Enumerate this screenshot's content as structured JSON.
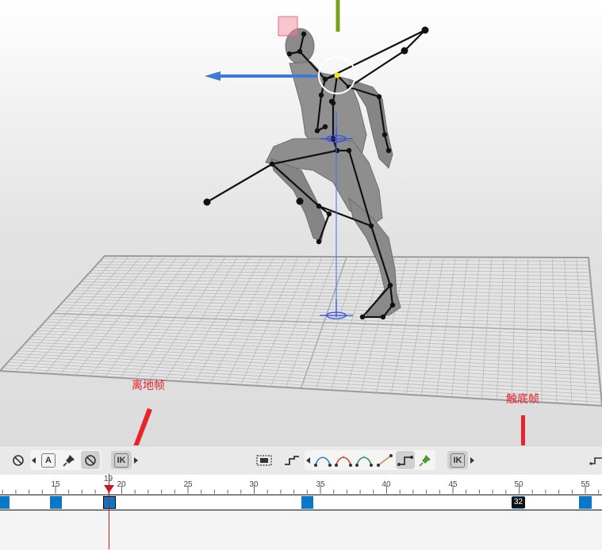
{
  "annotations": {
    "takeoff_label": "离地帧",
    "landing_label": "触底帧"
  },
  "toolbar": {
    "left_icons": [
      "no-key-icon",
      "auto-key-icon",
      "pin-icon",
      "no-key-icon"
    ],
    "auto_key_label": "A",
    "ik_label": "IK",
    "ik_label_2": "IK",
    "right_icons": [
      "frame-selection-icon",
      "step-interpolation-icon",
      "spline-icon",
      "spline-v-icon",
      "spline-c-icon",
      "linear-icon",
      "step-icon",
      "pin-icon"
    ]
  },
  "timeline": {
    "current_frame": "19",
    "selected_frame": "32",
    "ruler_labels": [
      "15",
      "20",
      "25",
      "30",
      "35",
      "40",
      "45",
      "50",
      "55"
    ],
    "keyframes": [
      11,
      15,
      19,
      34,
      51,
      55
    ],
    "colors": {
      "key": "#0a77c8",
      "playhead": "#c51c1c",
      "annotation": "#e8232a"
    }
  },
  "viewport": {
    "gizmo_icons": [
      "move-x-arrow-icon",
      "move-y-arrow-icon",
      "rotate-ring-icon",
      "root-marker-icon"
    ]
  }
}
